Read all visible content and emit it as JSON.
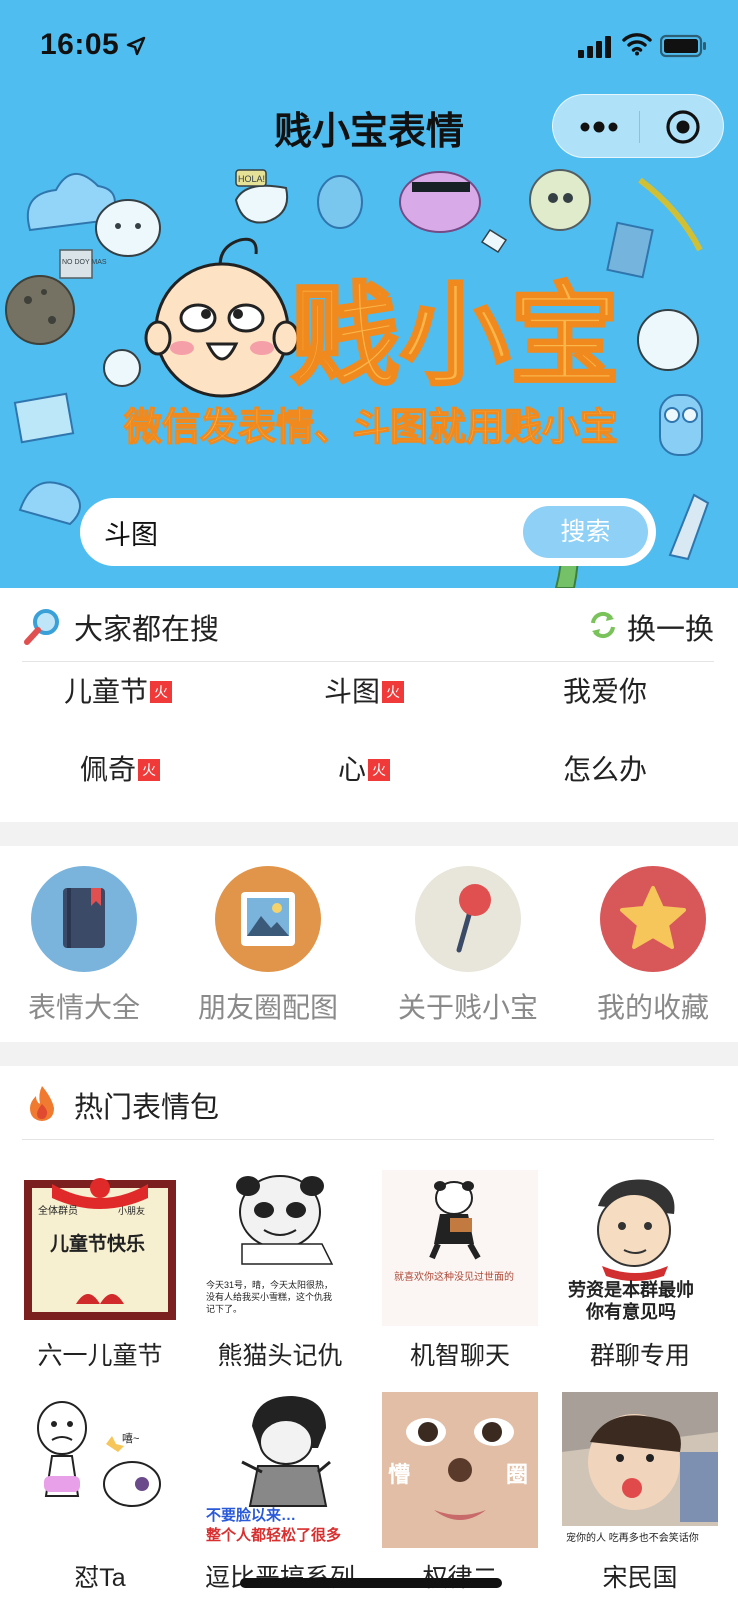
{
  "status_bar": {
    "time": "16:05"
  },
  "header": {
    "title": "贱小宝表情"
  },
  "banner": {
    "logo_text": "贱小宝",
    "slogan": "微信发表情、斗图就用贱小宝",
    "sticker_texts": [
      "HOLA!",
      "NO DOY MAS"
    ]
  },
  "search": {
    "value": "斗图",
    "button_label": "搜索"
  },
  "hot_search": {
    "title": "大家都在搜",
    "refresh_label": "换一换",
    "fire_badge": "火",
    "keywords": [
      "儿童节",
      "斗图",
      "我爱你",
      "佩奇",
      "心",
      "怎么办"
    ]
  },
  "features": {
    "items": [
      {
        "label": "表情大全",
        "color": "#7ab4dc"
      },
      {
        "label": "朋友圈配图",
        "color": "#e0954a"
      },
      {
        "label": "关于贱小宝",
        "color": "#e8e6da"
      },
      {
        "label": "我的收藏",
        "color": "#d8585a"
      }
    ]
  },
  "hot_packs": {
    "title": "热门表情包",
    "items": [
      {
        "name": "六一儿童节",
        "thumb_texts": [
          "全体群员",
          "小朋友",
          "儿童节快乐"
        ]
      },
      {
        "name": "熊猫头记仇",
        "thumb_texts": [
          "今天31号，晴，今天太阳很热，",
          "没有人给我买小雪糕，这个仇我",
          "记下了。"
        ]
      },
      {
        "name": "机智聊天",
        "thumb_texts": [
          "就喜欢你这种没见过世面的"
        ]
      },
      {
        "name": "群聊专用",
        "thumb_texts": [
          "劳资是本群最帅",
          "你有意见吗"
        ]
      },
      {
        "name": "怼Ta",
        "thumb_texts": [
          "嘻~"
        ]
      },
      {
        "name": "逗比恶搞系列",
        "thumb_texts": [
          "不要脸以来…",
          "整个人都轻松了很多"
        ]
      },
      {
        "name": "权律二",
        "thumb_texts": [
          "懵",
          "圈"
        ]
      },
      {
        "name": "宋民国",
        "thumb_texts": [
          "宠你的人 吃再多也不会笑话你"
        ]
      }
    ]
  }
}
